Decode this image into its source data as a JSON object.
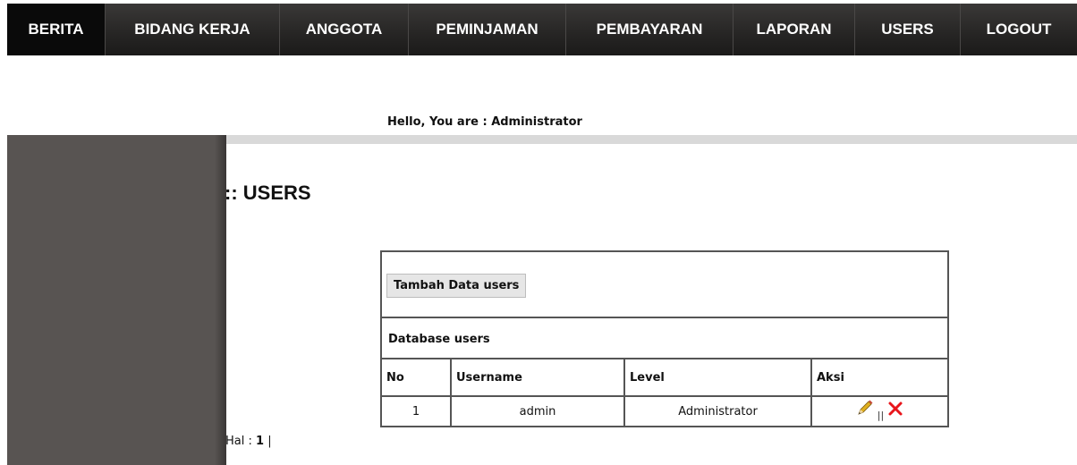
{
  "nav": {
    "items": [
      {
        "label": "BERITA",
        "active": true
      },
      {
        "label": "BIDANG KERJA",
        "active": false
      },
      {
        "label": "ANGGOTA",
        "active": false
      },
      {
        "label": "PEMINJAMAN",
        "active": false
      },
      {
        "label": "PEMBAYARAN",
        "active": false
      },
      {
        "label": "LAPORAN",
        "active": false
      },
      {
        "label": "USERS",
        "active": false
      },
      {
        "label": "LOGOUT",
        "active": false
      }
    ]
  },
  "greeting": "Hello, You are : Administrator",
  "page_title": ":: USERS",
  "table": {
    "add_button": "Tambah Data users",
    "section_label": "Database users",
    "headers": [
      "No",
      "Username",
      "Level",
      "Aksi"
    ],
    "rows": [
      {
        "no": "1",
        "username": "admin",
        "level": "Administrator",
        "separator": "||"
      }
    ],
    "edit_icon": "pencil-icon",
    "delete_icon": "close-x-icon"
  },
  "pagination": {
    "label": "Hal :",
    "page": "1",
    "separator": "|"
  },
  "colors": {
    "nav_bg": "#262524",
    "nav_active": "#0a0a0a",
    "sidebar": "#585452",
    "rule": "#d9d9d9",
    "delete_red": "#e8151b"
  }
}
